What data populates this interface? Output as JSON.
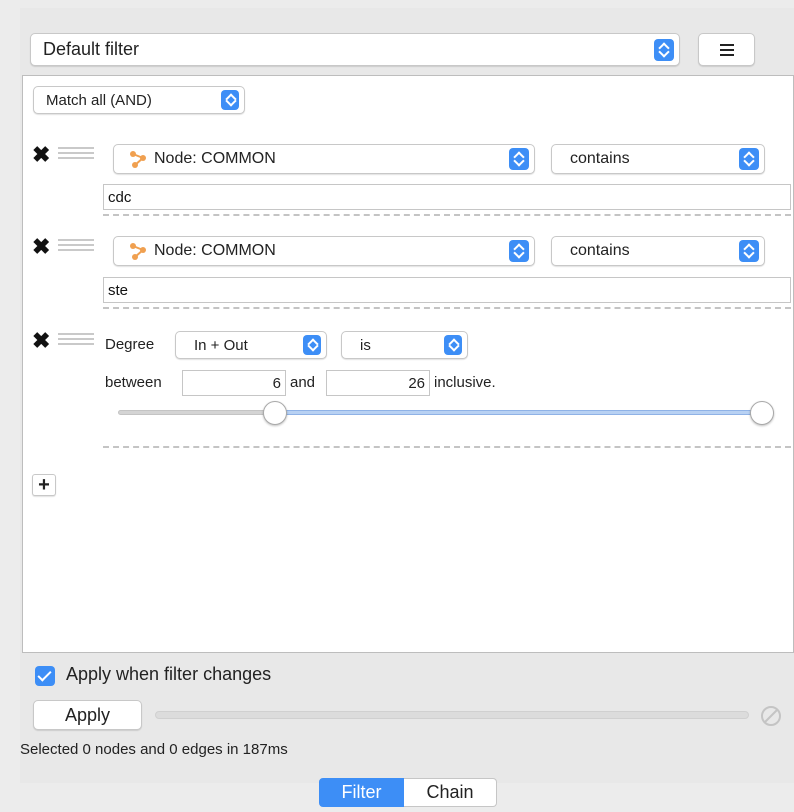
{
  "header": {
    "filter_select": "Default filter",
    "menu_icon": "hamburger-menu-icon"
  },
  "match_mode": "Match all (AND)",
  "rules": [
    {
      "column": "Node: COMMON",
      "operator": "contains",
      "value": "cdc",
      "column_icon": "node-network-icon"
    },
    {
      "column": "Node: COMMON",
      "operator": "contains",
      "value": "ste",
      "column_icon": "node-network-icon"
    }
  ],
  "degree_rule": {
    "label": "Degree",
    "direction": "In + Out",
    "operator": "is",
    "between_label": "between",
    "min": "6",
    "and_label": "and",
    "max": "26",
    "inclusive_label": "inclusive.",
    "slider_low_fraction": 0.23,
    "slider_high_fraction": 1.0
  },
  "add_button": "+",
  "apply_when_changes": {
    "label": "Apply when filter changes",
    "checked": true
  },
  "apply_button": "Apply",
  "status": "Selected 0 nodes and 0 edges in 187ms",
  "tabs": [
    "Filter",
    "Chain"
  ],
  "colors": {
    "accent": "#3d8ef6",
    "node_icon": "#f0a050"
  }
}
